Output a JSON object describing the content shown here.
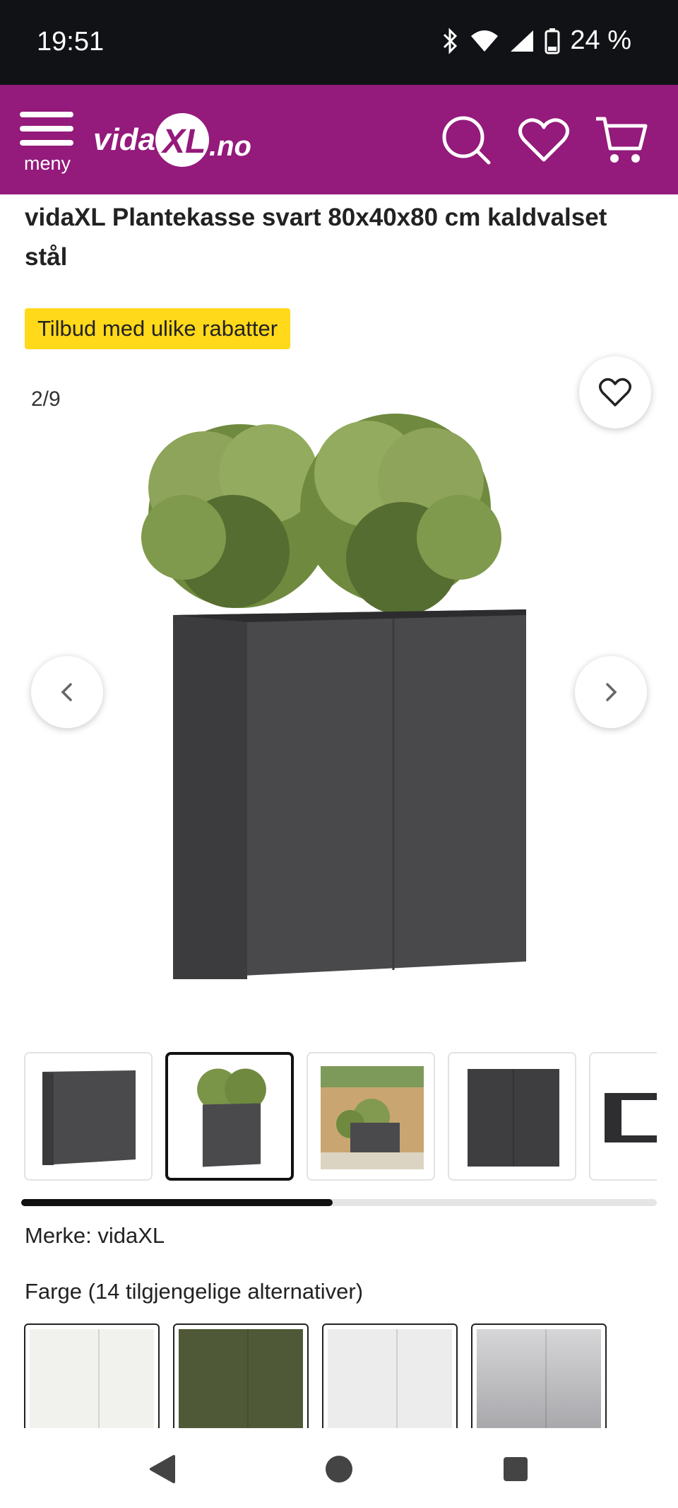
{
  "status": {
    "time": "19:51",
    "battery": "24 %"
  },
  "header": {
    "menu_label": "meny",
    "logo_text": "vidaXL.no"
  },
  "product": {
    "title": "vidaXL Plantekasse svart 80x40x80 cm kaldvalset stål",
    "promo": "Tilbud med ulike rabatter",
    "brand_line": "Merke: vidaXL",
    "color_label": "Farge (14 tilgjengelige alternativer)"
  },
  "gallery": {
    "counter": "2/9",
    "current_index": 2,
    "total_images": 9,
    "scroll_progress": 0.49
  },
  "colors": {
    "brand": "#941a7b",
    "promo_badge": "#ffd91a",
    "planter": "#4a4a4d"
  },
  "swatches": [
    {
      "name": "white",
      "color": "#f1f1ee"
    },
    {
      "name": "olive",
      "color": "#505937"
    },
    {
      "name": "white-light",
      "color": "#ececec"
    },
    {
      "name": "silver",
      "color": "#b8b8bc"
    }
  ],
  "icons": {
    "menu": "hamburger-icon",
    "search": "search-icon",
    "wishlist": "heart-icon",
    "cart": "cart-icon",
    "prev": "chevron-left-icon",
    "next": "chevron-right-icon",
    "back": "triangle-back-icon",
    "home": "circle-home-icon",
    "recents": "square-recents-icon"
  }
}
